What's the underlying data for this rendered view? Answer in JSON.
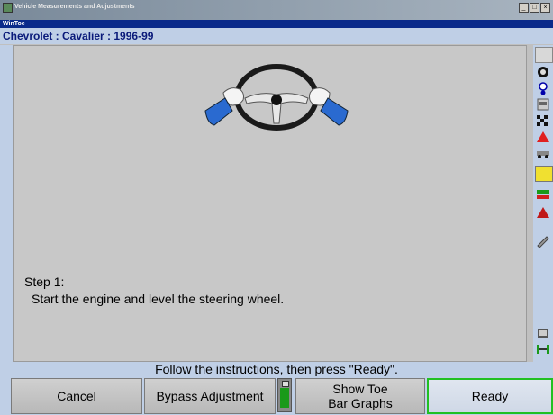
{
  "window": {
    "title": "Vehicle Measurements and Adjustments",
    "sub_title": "WinToe"
  },
  "vehicle": {
    "label": "Chevrolet : Cavalier : 1996-99"
  },
  "step": {
    "title": "Step 1:",
    "text": "Start the engine and level the steering wheel."
  },
  "instruction": "Follow the instructions, then press \"Ready\".",
  "buttons": {
    "cancel": "Cancel",
    "bypass": "Bypass Adjustment",
    "show_toe_line1": "Show Toe",
    "show_toe_line2": "Bar Graphs",
    "ready": "Ready"
  },
  "colors": {
    "ready_border": "#22c022",
    "subbar": "#0a2a8a",
    "vehicle_text": "#0a1a7a",
    "glove_cuff": "#2a6ad0"
  },
  "icons": [
    "alignment-icon",
    "reset-icon",
    "gauge-icon",
    "settings-icon",
    "spec-icon",
    "checker-icon",
    "vehicle-icon",
    "measure-icon",
    "wheel-icon",
    "flag-icon",
    "tool-icon",
    "print-icon",
    "axle-icon"
  ]
}
